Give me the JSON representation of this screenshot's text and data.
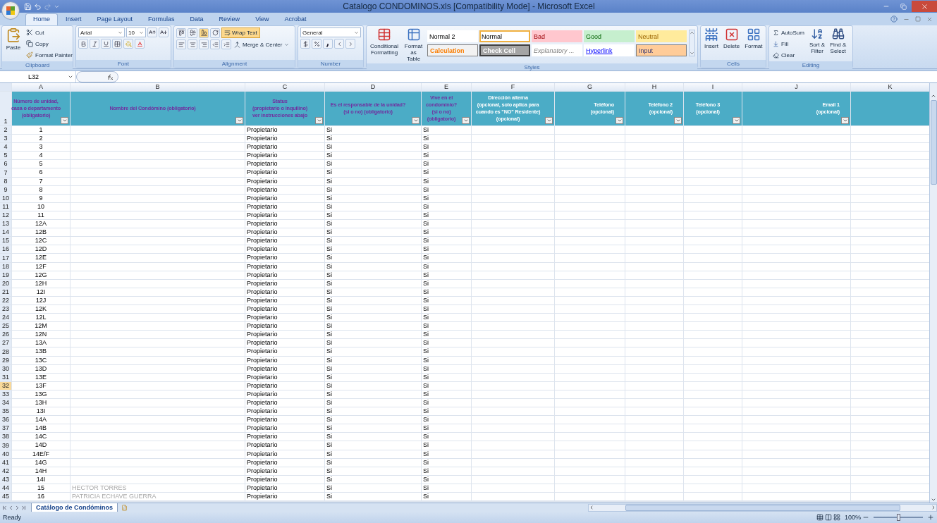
{
  "window": {
    "title": "Catalogo CONDOMINOS.xls  [Compatibility Mode] - Microsoft Excel"
  },
  "ribbon_tabs": [
    {
      "label": "Home",
      "selected": true
    },
    {
      "label": "Insert",
      "selected": false
    },
    {
      "label": "Page Layout",
      "selected": false
    },
    {
      "label": "Formulas",
      "selected": false
    },
    {
      "label": "Data",
      "selected": false
    },
    {
      "label": "Review",
      "selected": false
    },
    {
      "label": "View",
      "selected": false
    },
    {
      "label": "Acrobat",
      "selected": false
    }
  ],
  "ribbon": {
    "clipboard": {
      "paste": "Paste",
      "cut": "Cut",
      "copy": "Copy",
      "format_painter": "Format Painter",
      "group": "Clipboard"
    },
    "font": {
      "name": "Arial",
      "size": "10",
      "group": "Font"
    },
    "alignment": {
      "wrap_text": "Wrap Text",
      "wrap_on": true,
      "merge": "Merge & Center",
      "group": "Alignment"
    },
    "number": {
      "format": "General",
      "group": "Number"
    },
    "styles": {
      "conditional": "Conditional\nFormatting",
      "format_table": "Format\nas Table",
      "group": "Styles",
      "cells": [
        {
          "label": "Normal 2",
          "kind": "normal",
          "selected": false
        },
        {
          "label": "Normal",
          "kind": "normal",
          "selected": true
        },
        {
          "label": "Bad",
          "kind": "bad",
          "selected": false
        },
        {
          "label": "Good",
          "kind": "good",
          "selected": false
        },
        {
          "label": "Neutral",
          "kind": "neutral",
          "selected": false
        },
        {
          "label": "Calculation",
          "kind": "calculation",
          "selected": false
        },
        {
          "label": "Check Cell",
          "kind": "check",
          "selected": false
        },
        {
          "label": "Explanatory ...",
          "kind": "explanatory",
          "selected": false
        },
        {
          "label": "Hyperlink",
          "kind": "hyperlink",
          "selected": false
        },
        {
          "label": "Input",
          "kind": "input",
          "selected": false
        }
      ]
    },
    "cells": {
      "buttons": [
        "Insert",
        "Delete",
        "Format"
      ],
      "group": "Cells"
    },
    "editing": {
      "autosum": "AutoSum",
      "fill": "Fill",
      "clear": "Clear",
      "sort": "Sort &\nFilter",
      "find": "Find &\nSelect",
      "group": "Editing"
    }
  },
  "formula_bar": {
    "name_box": "L32"
  },
  "sheet": {
    "column_letters": [
      "A",
      "B",
      "C",
      "D",
      "E",
      "F",
      "G",
      "H",
      "I",
      "J",
      "K"
    ],
    "header_row": "1",
    "headers": [
      {
        "text": "Número de unidad,\ncasa o departamento\n(obligatorio)",
        "kind": "required"
      },
      {
        "text": "Nombre del Condómino (obligatorio)",
        "kind": "required"
      },
      {
        "text": "Status\n(propietario o inquilino)\nver instrucciones abajo",
        "kind": "required"
      },
      {
        "text": "Es el responsable de la unidad?\n(si o no) (obligatorio)",
        "kind": "required"
      },
      {
        "text": "Vive en el\ncondominio?\n(si o no)\n(obligatorio)",
        "kind": "required"
      },
      {
        "text": "Dirección alterna\n(opcional, solo aplica para\ncuando es \"NO\" Residente)\n(opcional)",
        "kind": "optional"
      },
      {
        "text": "Teléfono\n(opcional)",
        "kind": "optional"
      },
      {
        "text": "Teléfono 2\n(opcional)",
        "kind": "optional"
      },
      {
        "text": "Teléfono 3\n(opcional)",
        "kind": "optional"
      },
      {
        "text": "Email 1\n(opcional)",
        "kind": "optional"
      }
    ],
    "rows": [
      {
        "num": "2",
        "unit": "1",
        "status": "Propietario",
        "responsible": "Si",
        "lives": "Si",
        "selected": false
      },
      {
        "num": "3",
        "unit": "2",
        "status": "Propietario",
        "responsible": "Si",
        "lives": "Si",
        "selected": false
      },
      {
        "num": "4",
        "unit": "3",
        "status": "Propietario",
        "responsible": "Si",
        "lives": "Si",
        "selected": false
      },
      {
        "num": "5",
        "unit": "4",
        "status": "Propietario",
        "responsible": "Si",
        "lives": "Si",
        "selected": false
      },
      {
        "num": "6",
        "unit": "5",
        "status": "Propietario",
        "responsible": "Si",
        "lives": "Si",
        "selected": false
      },
      {
        "num": "7",
        "unit": "6",
        "status": "Propietario",
        "responsible": "Si",
        "lives": "Si",
        "selected": false
      },
      {
        "num": "8",
        "unit": "7",
        "status": "Propietario",
        "responsible": "Si",
        "lives": "Si",
        "selected": false
      },
      {
        "num": "9",
        "unit": "8",
        "status": "Propietario",
        "responsible": "Si",
        "lives": "Si",
        "selected": false
      },
      {
        "num": "10",
        "unit": "9",
        "status": "Propietario",
        "responsible": "Si",
        "lives": "Si",
        "selected": false
      },
      {
        "num": "11",
        "unit": "10",
        "status": "Propietario",
        "responsible": "Si",
        "lives": "Si",
        "selected": false
      },
      {
        "num": "12",
        "unit": "11",
        "status": "Propietario",
        "responsible": "Si",
        "lives": "Si",
        "selected": false
      },
      {
        "num": "13",
        "unit": "12A",
        "status": "Propietario",
        "responsible": "Si",
        "lives": "Si",
        "selected": false
      },
      {
        "num": "14",
        "unit": "12B",
        "status": "Propietario",
        "responsible": "Si",
        "lives": "Si",
        "selected": false
      },
      {
        "num": "15",
        "unit": "12C",
        "status": "Propietario",
        "responsible": "Si",
        "lives": "Si",
        "selected": false
      },
      {
        "num": "16",
        "unit": "12D",
        "status": "Propietario",
        "responsible": "Si",
        "lives": "Si",
        "selected": false
      },
      {
        "num": "17",
        "unit": "12E",
        "status": "Propietario",
        "responsible": "Si",
        "lives": "Si",
        "selected": false
      },
      {
        "num": "18",
        "unit": "12F",
        "status": "Propietario",
        "responsible": "Si",
        "lives": "Si",
        "selected": false
      },
      {
        "num": "19",
        "unit": "12G",
        "status": "Propietario",
        "responsible": "Si",
        "lives": "Si",
        "selected": false
      },
      {
        "num": "20",
        "unit": "12H",
        "status": "Propietario",
        "responsible": "Si",
        "lives": "Si",
        "selected": false
      },
      {
        "num": "21",
        "unit": "12I",
        "status": "Propietario",
        "responsible": "Si",
        "lives": "Si",
        "selected": false
      },
      {
        "num": "22",
        "unit": "12J",
        "status": "Propietario",
        "responsible": "Si",
        "lives": "Si",
        "selected": false
      },
      {
        "num": "23",
        "unit": "12K",
        "status": "Propietario",
        "responsible": "Si",
        "lives": "Si",
        "selected": false
      },
      {
        "num": "24",
        "unit": "12L",
        "status": "Propietario",
        "responsible": "Si",
        "lives": "Si",
        "selected": false
      },
      {
        "num": "25",
        "unit": "12M",
        "status": "Propietario",
        "responsible": "Si",
        "lives": "Si",
        "selected": false
      },
      {
        "num": "26",
        "unit": "12N",
        "status": "Propietario",
        "responsible": "Si",
        "lives": "Si",
        "selected": false
      },
      {
        "num": "27",
        "unit": "13A",
        "status": "Propietario",
        "responsible": "Si",
        "lives": "Si",
        "selected": false
      },
      {
        "num": "28",
        "unit": "13B",
        "status": "Propietario",
        "responsible": "Si",
        "lives": "Si",
        "selected": false
      },
      {
        "num": "29",
        "unit": "13C",
        "status": "Propietario",
        "responsible": "Si",
        "lives": "Si",
        "selected": false
      },
      {
        "num": "30",
        "unit": "13D",
        "status": "Propietario",
        "responsible": "Si",
        "lives": "Si",
        "selected": false
      },
      {
        "num": "31",
        "unit": "13E",
        "status": "Propietario",
        "responsible": "Si",
        "lives": "Si",
        "selected": false
      },
      {
        "num": "32",
        "unit": "13F",
        "status": "Propietario",
        "responsible": "Si",
        "lives": "Si",
        "selected": true
      },
      {
        "num": "33",
        "unit": "13G",
        "status": "Propietario",
        "responsible": "Si",
        "lives": "Si",
        "selected": false
      },
      {
        "num": "34",
        "unit": "13H",
        "status": "Propietario",
        "responsible": "Si",
        "lives": "Si",
        "selected": false
      },
      {
        "num": "35",
        "unit": "13I",
        "status": "Propietario",
        "responsible": "Si",
        "lives": "Si",
        "selected": false
      },
      {
        "num": "36",
        "unit": "14A",
        "status": "Propietario",
        "responsible": "Si",
        "lives": "Si",
        "selected": false
      },
      {
        "num": "37",
        "unit": "14B",
        "status": "Propietario",
        "responsible": "Si",
        "lives": "Si",
        "selected": false
      },
      {
        "num": "38",
        "unit": "14C",
        "status": "Propietario",
        "responsible": "Si",
        "lives": "Si",
        "selected": false
      },
      {
        "num": "39",
        "unit": "14D",
        "status": "Propietario",
        "responsible": "Si",
        "lives": "Si",
        "selected": false
      },
      {
        "num": "40",
        "unit": "14E/F",
        "status": "Propietario",
        "responsible": "Si",
        "lives": "Si",
        "selected": false
      },
      {
        "num": "41",
        "unit": "14G",
        "status": "Propietario",
        "responsible": "Si",
        "lives": "Si",
        "selected": false
      },
      {
        "num": "42",
        "unit": "14H",
        "status": "Propietario",
        "responsible": "Si",
        "lives": "Si",
        "selected": false
      },
      {
        "num": "43",
        "unit": "14I",
        "status": "Propietario",
        "responsible": "Si",
        "lives": "Si",
        "selected": false
      },
      {
        "num": "44",
        "unit": "15",
        "name": "HECTOR TORRES",
        "status": "Propietario",
        "responsible": "Si",
        "lives": "Si",
        "selected": false
      },
      {
        "num": "45",
        "unit": "16",
        "name": "PATRICIA ECHAVE GUERRA",
        "status": "Propietario",
        "responsible": "Si",
        "lives": "Si",
        "selected": false
      }
    ]
  },
  "sheet_tabs": [
    {
      "label": "Catálogo de Condóminos",
      "selected": true
    }
  ],
  "status_bar": {
    "status": "Ready",
    "zoom": "100%",
    "zoom_slider": {
      "level": 0.5
    }
  }
}
